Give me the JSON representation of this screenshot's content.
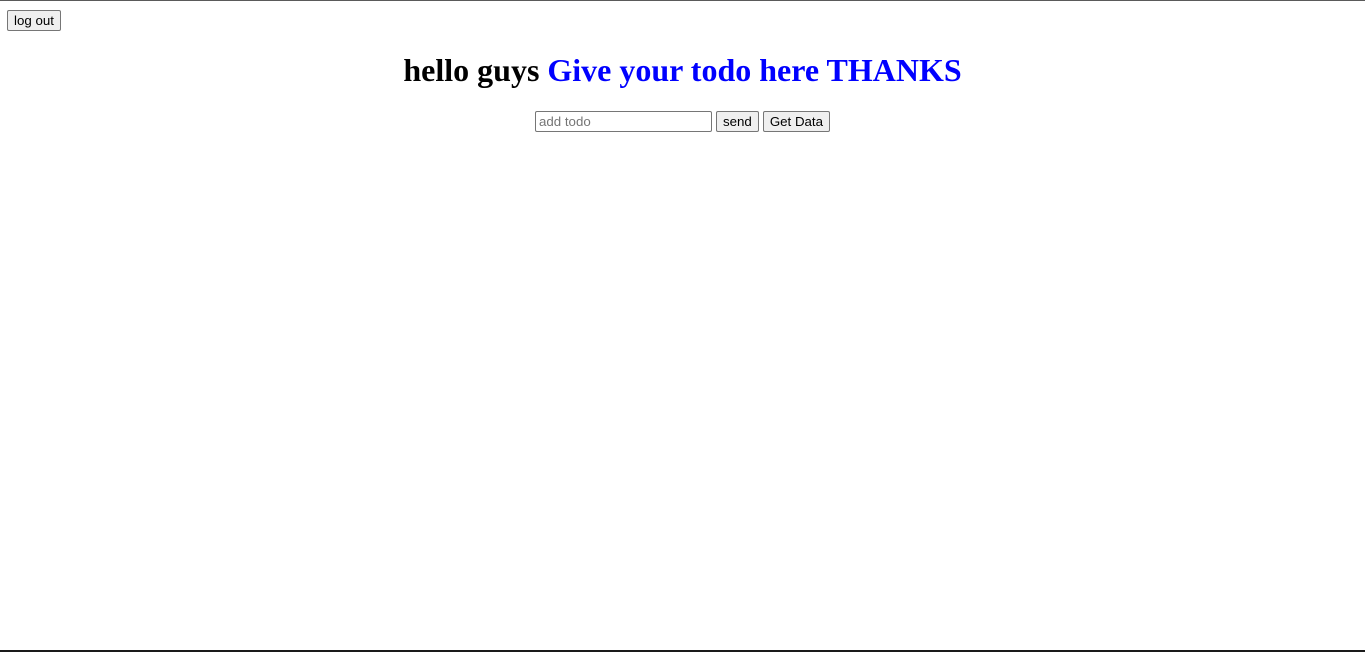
{
  "header": {
    "logout_label": "log out"
  },
  "title": {
    "greeting": "hello guys",
    "prompt": "Give your todo here THANKS"
  },
  "todo_form": {
    "input_placeholder": "add todo",
    "input_value": "",
    "send_label": "send",
    "get_data_label": "Get Data"
  },
  "colors": {
    "accent": "#0000ff",
    "text": "#000000",
    "button_bg": "#efefef",
    "button_border": "#767676"
  }
}
